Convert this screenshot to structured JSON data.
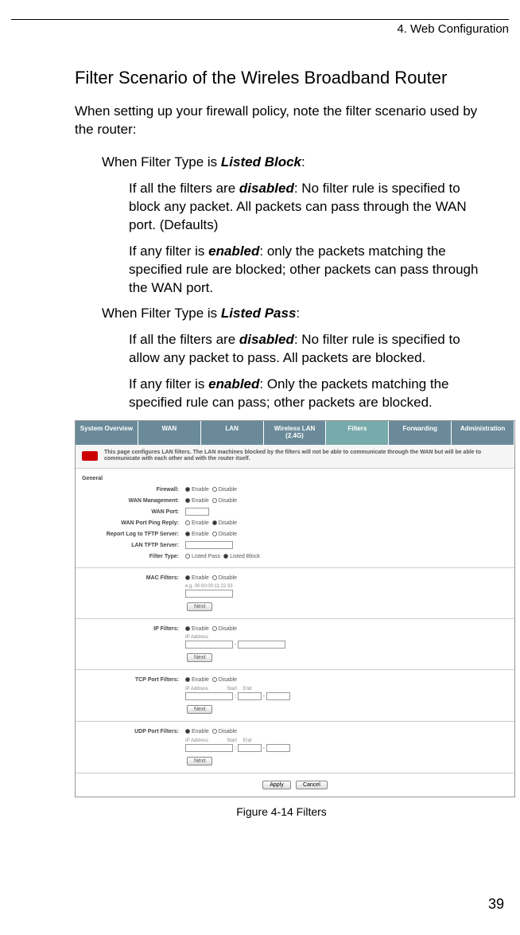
{
  "header": "4. Web Configuration",
  "title": "Filter Scenario of the Wireles Broadband Router",
  "intro": "When setting up your firewall policy, note the filter scenario used by the router:",
  "block": {
    "heading_pre": "When Filter Type is ",
    "heading_em": "Listed Block",
    "heading_post": ":",
    "disabled_pre": "If all the filters are ",
    "disabled_em": "disabled",
    "disabled_post": ": No filter rule is specified to block any packet. All packets can pass through the WAN port. (Defaults)",
    "enabled_pre": "If any filter is ",
    "enabled_em": "enabled",
    "enabled_post": ": only the packets matching the specified rule are blocked; other packets can pass through the WAN port."
  },
  "pass": {
    "heading_pre": "When Filter Type is ",
    "heading_em": "Listed Pass",
    "heading_post": ":",
    "disabled_pre": "If all the filters are ",
    "disabled_em": "disabled",
    "disabled_post": ": No filter rule is specified to allow any packet to pass. All packets are blocked.",
    "enabled_pre": "If any filter is ",
    "enabled_em": "enabled",
    "enabled_post": ": Only the packets matching the specified rule can pass; other packets are blocked."
  },
  "screenshot": {
    "tabs": [
      "System Overview",
      "WAN",
      "LAN",
      "Wireless LAN (2.4G)",
      "Filters",
      "Forwarding",
      "Administration"
    ],
    "note": "This page configures LAN filters. The LAN machines blocked by the filters will not be able to communicate through the WAN but will be able to communicate with each other and with the router itself.",
    "general": {
      "title": "General",
      "rows": {
        "firewall": "Firewall:",
        "wan_mgmt": "WAN Management:",
        "wan_port": "WAN Port:",
        "ping": "WAN Port Ping Reply:",
        "tftp": "Report Log to TFTP Server:",
        "tftp_server": "LAN TFTP Server:",
        "filter_type": "Filter Type:"
      },
      "opts": {
        "enable": "Enable",
        "disable": "Disable",
        "listed_pass": "Listed Pass",
        "listed_block": "Listed Block"
      }
    },
    "mac": {
      "title": "MAC Filters:"
    },
    "ip": {
      "title": "IP Filters:"
    },
    "tcp": {
      "title": "TCP Port Filters:"
    },
    "udp": {
      "title": "UDP Port Filters:"
    },
    "btn_next": "Next",
    "btn_apply": "Apply",
    "btn_cancel": "Cancel",
    "tiny": {
      "mac_example": "e.g. 00:00:00:11:22:33",
      "ip_addr": "IP Address",
      "start": "Start",
      "end": "End"
    }
  },
  "caption": "Figure 4-14    Filters",
  "page_num": "39"
}
